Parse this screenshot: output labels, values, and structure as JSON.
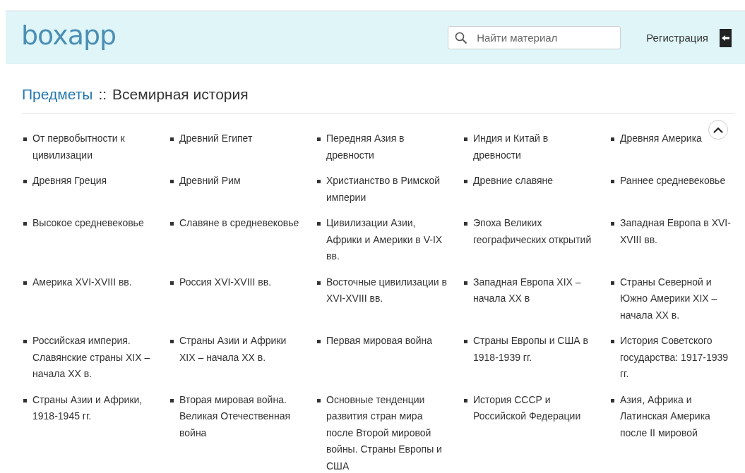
{
  "header": {
    "logo": "boxapp",
    "search": {
      "placeholder": "Найти материал"
    },
    "register_link": "Регистрация"
  },
  "breadcrumb": {
    "parent": "Предметы",
    "separator": "::",
    "current": "Всемирная история"
  },
  "topics": [
    "От первобытности к цивилизации",
    "Древний Египет",
    "Передняя Азия в древности",
    "Индия и Китай в древности",
    "Древняя Америка",
    "Древняя Греция",
    "Древний Рим",
    "Христианство в Римской империи",
    "Древние славяне",
    "Раннее средневековье",
    "Высокое средневековье",
    "Славяне в средневековье",
    "Цивилизации Азии, Африки и Америки в V-IX вв.",
    "Эпоха Великих географических открытий",
    "Западная Европа в XVI-XVIII вв.",
    "Америка XVI-XVIII вв.",
    "Россия XVI-XVIII вв.",
    "Восточные цивилизации в XVI-XVIII вв.",
    "Западная Европа XIX – начала XX в",
    "Страны Северной и Южно Америки XIX – начала XX в.",
    "Российская империя. Славянские страны XIX – начала XX в.",
    "Страны Азии и Африки XIX – начала XX в.",
    "Первая мировая война",
    "Страны Европы и США в 1918-1939 гг.",
    "История Советского государства: 1917-1939 гг.",
    "Страны Азии и Африки, 1918-1945 гг.",
    "Вторая мировая война. Великая Отечественная война",
    "Основные тенденции развития стран мира после Второй мировой войны. Страны Европы и США",
    "История СССР и Российской Федерации",
    "Азия, Африка и Латинская Америка после II мировой"
  ]
}
